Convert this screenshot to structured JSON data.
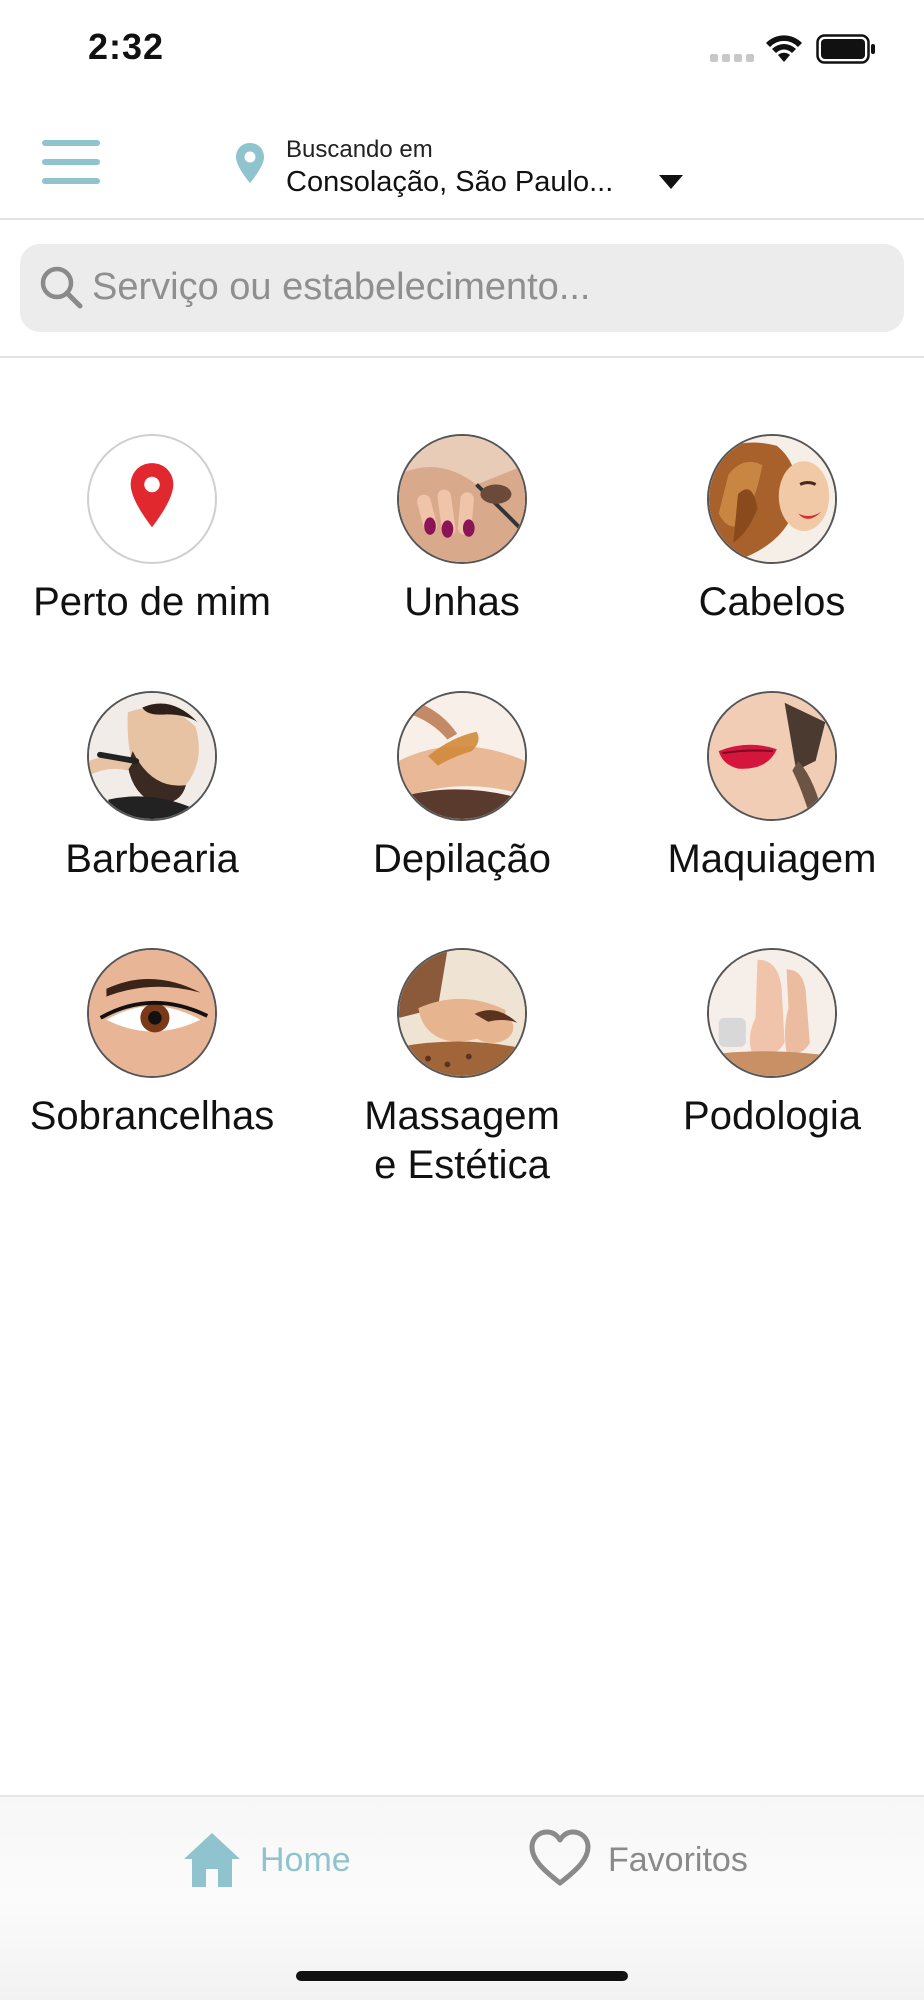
{
  "status_bar": {
    "time": "2:32"
  },
  "header": {
    "location_caption": "Buscando em",
    "location_value": "Consolação, São Paulo..."
  },
  "search": {
    "placeholder": "Serviço ou estabelecimento..."
  },
  "categories": [
    {
      "label": "Perto de mim",
      "icon": "location-pin-icon"
    },
    {
      "label": "Unhas",
      "icon": "nails-image"
    },
    {
      "label": "Cabelos",
      "icon": "hair-image"
    },
    {
      "label": "Barbearia",
      "icon": "barber-image"
    },
    {
      "label": "Depilação",
      "icon": "waxing-image"
    },
    {
      "label": "Maquiagem",
      "icon": "makeup-image"
    },
    {
      "label": "Sobrancelhas",
      "icon": "eyebrow-image"
    },
    {
      "label": "Massagem\ne Estética",
      "icon": "massage-image"
    },
    {
      "label": "Podologia",
      "icon": "feet-image"
    }
  ],
  "tab_bar": {
    "home_label": "Home",
    "favorites_label": "Favoritos"
  },
  "colors": {
    "accent": "#8fc4cf",
    "pin_red": "#e0282e",
    "inactive_tab": "#8a8a8a",
    "search_bg": "#ececec"
  }
}
